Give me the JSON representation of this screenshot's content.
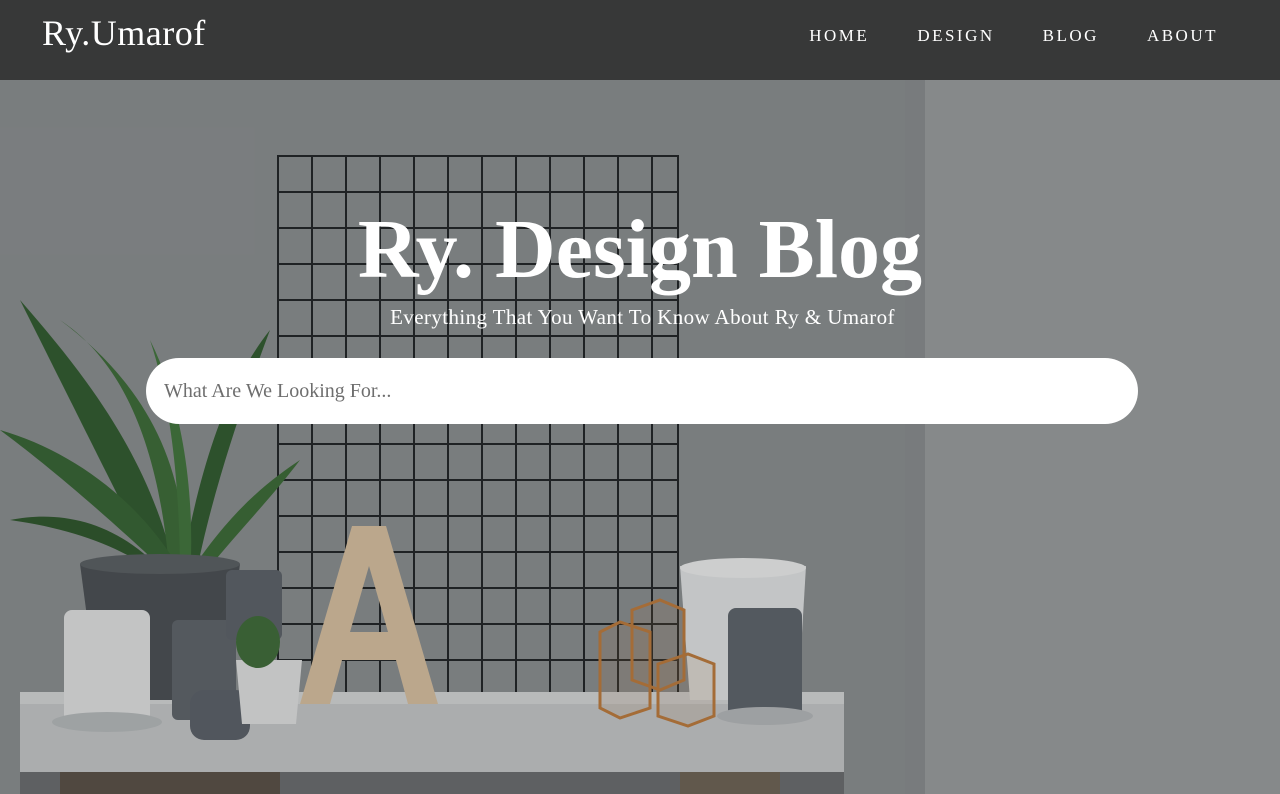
{
  "nav": {
    "brand": "Ry.Umarof",
    "links": [
      "HOME",
      "DESIGN",
      "BLOG",
      "ABOUT"
    ]
  },
  "hero": {
    "title": "Ry. Design Blog",
    "subtitle": "Everything That You Want To Know About Ry & Umarof",
    "background": "photo-of-shelf-with-plants-candles-and-wire-grid"
  },
  "search": {
    "placeholder": "What Are We Looking For...",
    "value": ""
  },
  "colors": {
    "navbar": "#373838",
    "text": "#ffffff",
    "search_bg": "#ffffff"
  }
}
